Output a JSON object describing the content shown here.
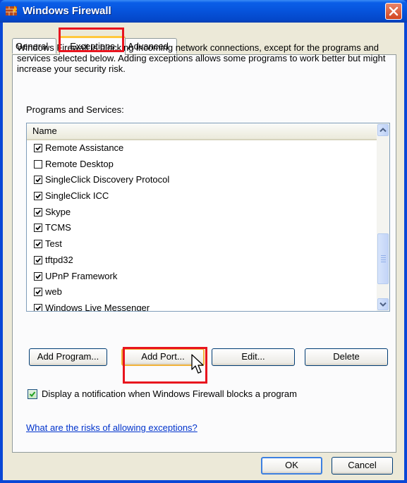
{
  "window": {
    "title": "Windows Firewall"
  },
  "tabs": [
    "General",
    "Exceptions",
    "Advanced"
  ],
  "active_tab": "Exceptions",
  "description": "Windows Firewall is blocking incoming network connections, except for the programs and services selected below. Adding exceptions allows some programs to work better but might increase your security risk.",
  "programs_label": "Programs and Services:",
  "list": {
    "column_header": "Name",
    "items": [
      {
        "label": "Remote Assistance",
        "checked": true
      },
      {
        "label": "Remote Desktop",
        "checked": false
      },
      {
        "label": "SingleClick Discovery Protocol",
        "checked": true
      },
      {
        "label": "SingleClick ICC",
        "checked": true
      },
      {
        "label": "Skype",
        "checked": true
      },
      {
        "label": "TCMS",
        "checked": true
      },
      {
        "label": "Test",
        "checked": true
      },
      {
        "label": "tftpd32",
        "checked": true
      },
      {
        "label": "UPnP Framework",
        "checked": true
      },
      {
        "label": "web",
        "checked": true
      },
      {
        "label": "Windows Live Messenger",
        "checked": true
      }
    ]
  },
  "buttons": {
    "add_program": "Add Program...",
    "add_port": "Add Port...",
    "edit": "Edit...",
    "delete": "Delete",
    "ok": "OK",
    "cancel": "Cancel"
  },
  "notify": {
    "label": "Display a notification when Windows Firewall blocks a program",
    "checked": true
  },
  "help_link": "What are the risks of allowing exceptions?",
  "colors": {
    "highlight": "#e8141e",
    "titlebar": "#0653db",
    "link": "#0033cc"
  }
}
